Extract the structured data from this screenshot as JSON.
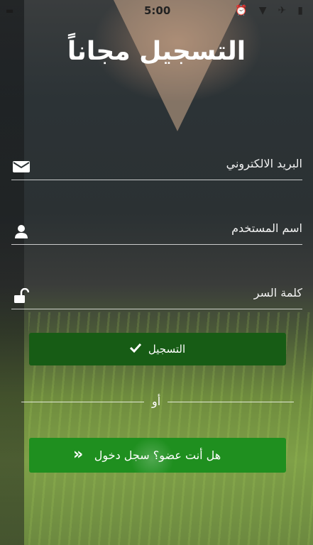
{
  "status_bar": {
    "time": "5:00"
  },
  "header": {
    "title": "التسجيل مجاناً"
  },
  "form": {
    "email": {
      "label": "البريد الالكتروني",
      "icon": "envelope-icon"
    },
    "username": {
      "label": "اسم المستخدم",
      "icon": "user-icon"
    },
    "password": {
      "label": "كلمة السر",
      "icon": "unlock-icon"
    }
  },
  "actions": {
    "register_label": "التسجيل",
    "or_label": "أو",
    "login_label": "هل أنت عضو؟ سجل دخول"
  },
  "colors": {
    "register_button": "#175c15",
    "login_button": "#1f8f1f"
  }
}
